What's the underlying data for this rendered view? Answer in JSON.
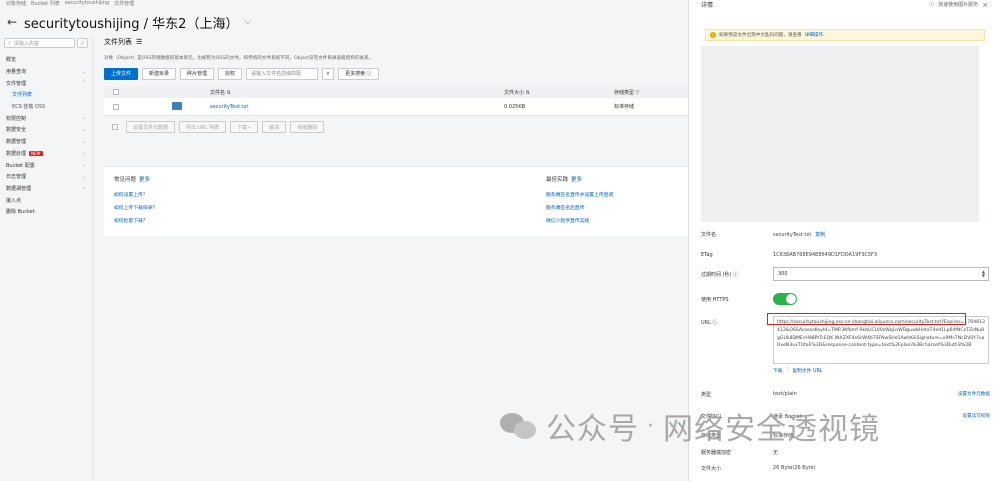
{
  "breadcrumbs": [
    "对象存储",
    "Bucket 列表",
    "securitytoushijing",
    "文件管理"
  ],
  "header": {
    "title": "securitytoushijing / 华东2（上海）"
  },
  "sidebar": {
    "search_placeholder": "请输入内容",
    "items": [
      {
        "label": "概览",
        "arrow": "",
        "sub": false,
        "active": false,
        "badge": ""
      },
      {
        "label": "用量查询",
        "arrow": "⌄",
        "sub": false,
        "active": false,
        "badge": ""
      },
      {
        "label": "文件管理",
        "arrow": "⌃",
        "sub": false,
        "active": false,
        "badge": ""
      },
      {
        "label": "文件列表",
        "arrow": "",
        "sub": true,
        "active": true,
        "badge": ""
      },
      {
        "label": "ECS 挂载 OSS",
        "arrow": "",
        "sub": true,
        "active": false,
        "badge": ""
      },
      {
        "label": "权限控制",
        "arrow": "⌄",
        "sub": false,
        "active": false,
        "badge": ""
      },
      {
        "label": "数据安全",
        "arrow": "⌄",
        "sub": false,
        "active": false,
        "badge": ""
      },
      {
        "label": "数据管理",
        "arrow": "⌄",
        "sub": false,
        "active": false,
        "badge": ""
      },
      {
        "label": "数据处理",
        "arrow": "⌄",
        "sub": false,
        "active": false,
        "badge": "NEW"
      },
      {
        "label": "Bucket 配置",
        "arrow": "⌄",
        "sub": false,
        "active": false,
        "badge": ""
      },
      {
        "label": "日志管理",
        "arrow": "⌄",
        "sub": false,
        "active": false,
        "badge": ""
      },
      {
        "label": "数据湖管理",
        "arrow": "⌄",
        "sub": false,
        "active": false,
        "badge": ""
      },
      {
        "label": "接入点",
        "arrow": "",
        "sub": false,
        "active": false,
        "badge": ""
      },
      {
        "label": "删除 Bucket",
        "arrow": "",
        "sub": false,
        "active": false,
        "badge": ""
      }
    ]
  },
  "main": {
    "section_title": "文件列表",
    "description": "对象（Object）是OSS存储数据的基本单元，也被称为OSS的文件。和传统的文件系统不同，Object没有文件目录层级结构的关系。",
    "toolbar": {
      "upload": "上传文件",
      "new_dir": "新建目录",
      "fragments": "碎片管理",
      "auth": "授权",
      "search_placeholder": "请输入文件名前缀匹配",
      "more_search": "更多搜索"
    },
    "table": {
      "headers": {
        "name": "文件名",
        "size": "文件大小",
        "storage": "存储类型"
      },
      "rows": [
        {
          "name": "securityTest.txt",
          "size": "0.025KB",
          "storage": "标准存储"
        }
      ]
    },
    "bulk": [
      "设置文件元数据",
      "导出 URL 列表",
      "下载",
      "解冻",
      "彻底删除"
    ],
    "faq": {
      "title": "常见问题",
      "more": "更多",
      "items": [
        "如何设置上传？",
        "如何上传下载目录?",
        "如何批量下载?"
      ]
    },
    "practice": {
      "title": "最佳实践",
      "more": "更多",
      "items": [
        "服务端签名直传并设置上传回调",
        "服务端签名后直传",
        "微信小程序直传实践"
      ]
    }
  },
  "drawer": {
    "title": "详情",
    "top_action": "快速使用图片服务",
    "close": "×",
    "notice": "如果预览文件出现中文乱码问题，请查看",
    "notice_link": "详细操作",
    "fields": {
      "filename_label": "文件名",
      "filename": "securityTest.txt",
      "copy": "复制",
      "etag_label": "ETag",
      "etag": "1C638AB768E94E8649D1FDDA19F3C5F3",
      "expire_label": "过期时间 (秒) ⓘ",
      "expire_value": "300",
      "https_label": "使用 HTTPS",
      "url_label": "URL ⓘ",
      "url_value": "https://securitytoushijing.oss-cn-shanghai.aliyuncs.com/securityTest.txt?Expires=1704813412&OSSAccessKeyId=TMP.3Kfbmf RkbUCLV0zWqLnWDguwbHetaT4ed1Lp6dfNCzTZeNu8gGUk8DMEcH98PtTcEQK INXZXF4s6cW4bTSFNwSHd1AwhK&Signature=x9Ms7NcDV0Y7vaUveN3uxTUfoE%3D&response-content-type=text%2Fplain%3Bcharset%3Dutf-8%2B",
      "download": "下载",
      "copy_url": "复制文件 URL",
      "type_label": "类型",
      "type_value": "text/plain",
      "type_action": "设置文件元数据",
      "acl_label": "文件 ACL",
      "acl_value": "继承 Bucket",
      "acl_action": "设置读写权限",
      "storage_label": "存储类型",
      "storage_value": "标准存储",
      "encrypt_label": "服务器端加密",
      "encrypt_value": "无",
      "size_label": "文件大小",
      "size_value": "26 Byte(26 Byte)"
    }
  },
  "watermark": {
    "brand": "公众号",
    "separator": "·",
    "name": "网络安全透视镜"
  },
  "colors": {
    "accent": "#0070cc",
    "toggle_on": "#2bb24c",
    "highlight": "#e01b1b"
  }
}
